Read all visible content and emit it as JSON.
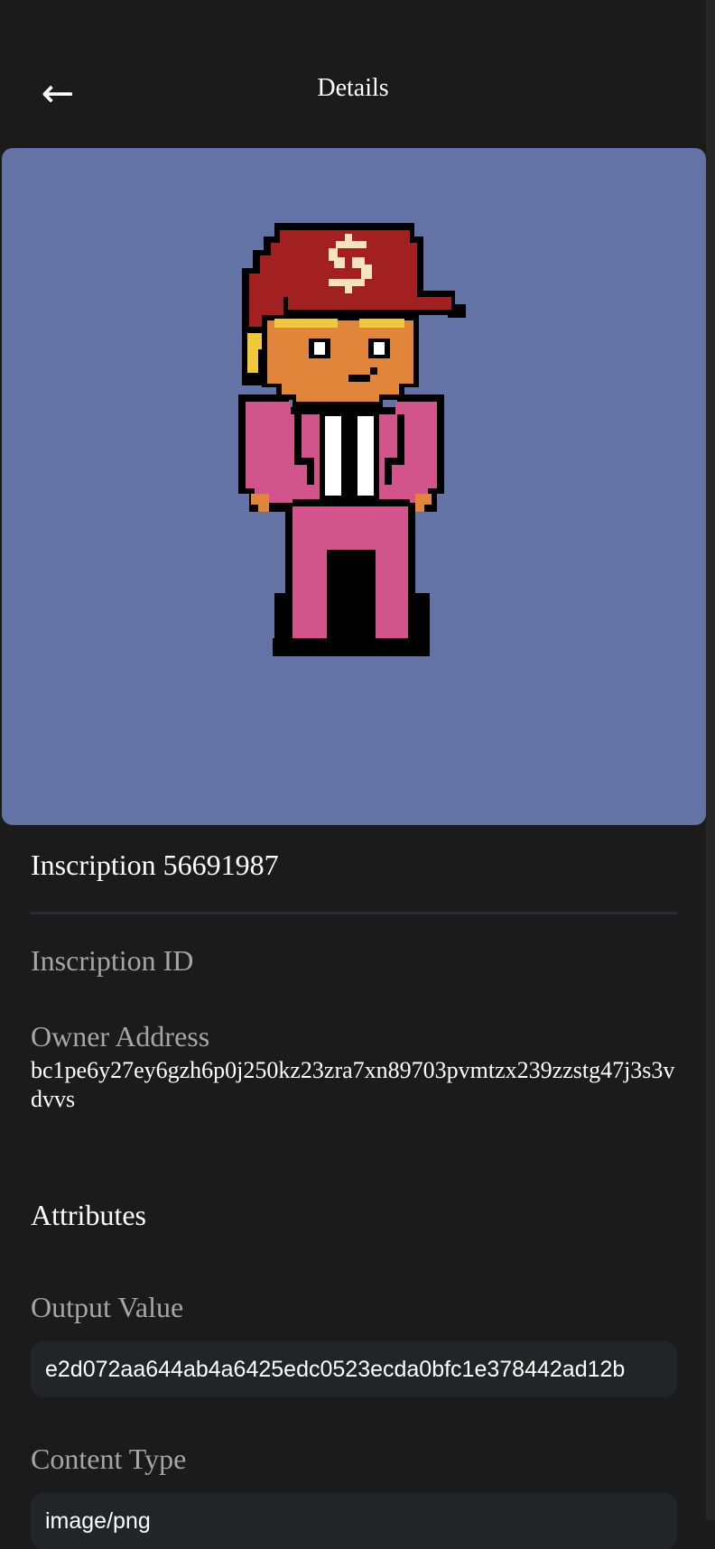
{
  "header": {
    "back_glyph": "←",
    "title": "Details"
  },
  "image": {
    "background_color": "#6373a6",
    "alt": "pixel art character wearing red dollar-sign cap and pink suit"
  },
  "inscription": {
    "title": "Inscription 56691987",
    "id_label": "Inscription ID",
    "owner_label": "Owner Address",
    "owner_value": "bc1pe6y27ey6gzh6p0j250kz23zra7xn89703pvmtzx239zzstg47j3s3vdvvs"
  },
  "attributes": {
    "heading": "Attributes",
    "output_value_label": "Output Value",
    "output_value": "e2d072aa644ab4a6425edc0523ecda0bfc1e378442ad12b",
    "content_type_label": "Content Type",
    "content_type_value": "image/png"
  },
  "colors": {
    "background": "#1b1b1b",
    "field_background": "#232428",
    "label_text": "#a6a6a6",
    "cap_red": "#a32020",
    "suit_pink": "#d1548a",
    "skin": "#e0853a",
    "hair": "#f0c83c"
  }
}
